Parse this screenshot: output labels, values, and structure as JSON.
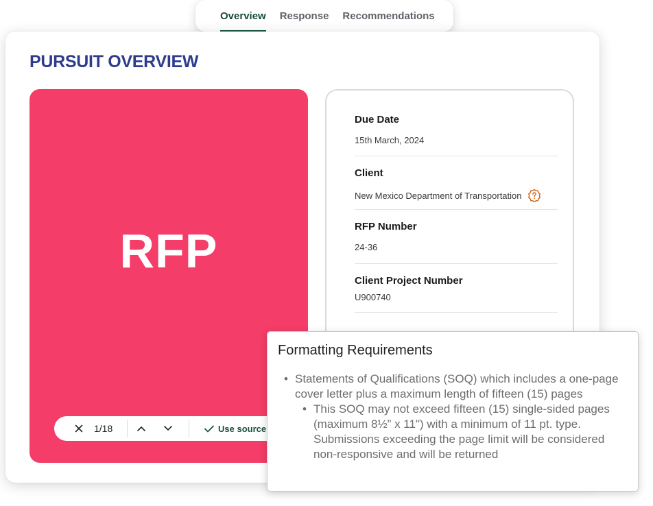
{
  "tabs": [
    {
      "label": "Overview",
      "active": true
    },
    {
      "label": "Response",
      "active": false
    },
    {
      "label": "Recommendations",
      "active": false
    }
  ],
  "page": {
    "title": "PURSUIT OVERVIEW"
  },
  "document": {
    "preview_text": "RFP",
    "page_indicator": "1/18",
    "use_source_label": "Use source",
    "background_color": "#f43d68"
  },
  "details": [
    {
      "label": "Due Date",
      "value": "15th March, 2024"
    },
    {
      "label": "Client",
      "value": "New Mexico Department of Transportation",
      "icon": "question-badge-icon"
    },
    {
      "label": "RFP Number",
      "value": "24-36"
    },
    {
      "label": "Client Project Number",
      "value": "U900740"
    }
  ],
  "formatting": {
    "title": "Formatting Requirements",
    "bullet": "Statements of Qualifications (SOQ) which includes a one-page cover letter plus a maximum length of fifteen (15) pages",
    "sub_bullet": "This SOQ may not exceed fifteen (15) single-sided pages (maximum 8½” x 11\") with a minimum of 11 pt. type. Submissions exceeding the page limit will be considered non-responsive and will be returned"
  },
  "colors": {
    "accent": "#184a3a",
    "title": "#2e3c8d",
    "warning_icon": "#d4661e"
  }
}
